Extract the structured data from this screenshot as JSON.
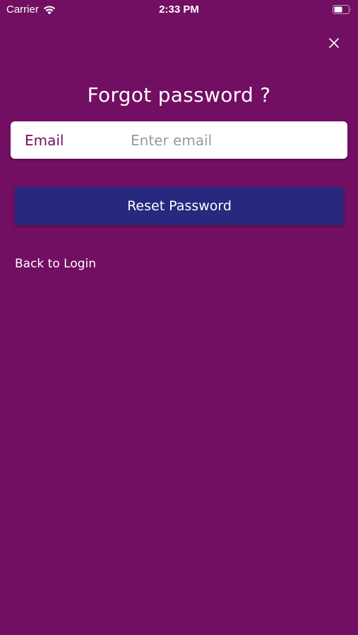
{
  "status_bar": {
    "carrier": "Carrier",
    "time": "2:33 PM",
    "wifi_icon": "wifi-icon",
    "battery_icon": "battery-icon"
  },
  "header": {
    "close_icon": "close-icon",
    "title": "Forgot password ?"
  },
  "form": {
    "email_label": "Email",
    "email_value": "",
    "email_placeholder": "Enter email",
    "reset_button_label": "Reset Password"
  },
  "footer": {
    "back_link_label": "Back to Login"
  },
  "colors": {
    "background": "#720f62",
    "button": "#28287e",
    "label": "#720f62",
    "text": "#ffffff"
  }
}
